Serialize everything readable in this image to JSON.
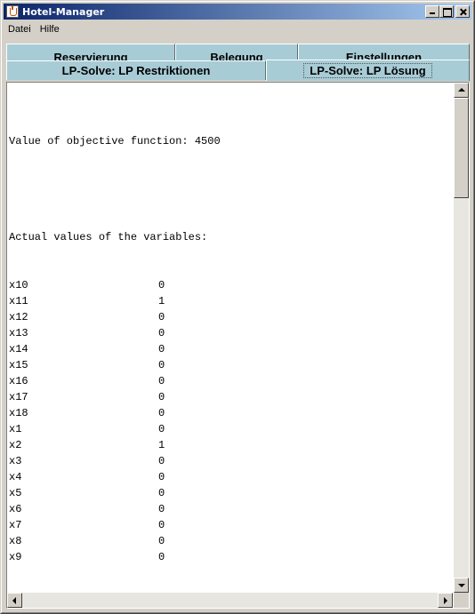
{
  "window": {
    "title": "Hotel-Manager"
  },
  "menu": [
    "Datei",
    "Hilfe"
  ],
  "tabs": {
    "row1": [
      "Reservierung",
      "Belegung",
      "Einstellungen"
    ],
    "row2": [
      "LP-Solve: LP Restriktionen",
      "LP-Solve: LP Lösung"
    ],
    "selected": "LP-Solve: LP Lösung"
  },
  "output": {
    "objective_line": "Value of objective function: 4500",
    "variables_header": "Actual values of the variables:",
    "variables": [
      {
        "name": "x10",
        "value": "0"
      },
      {
        "name": "x11",
        "value": "1"
      },
      {
        "name": "x12",
        "value": "0"
      },
      {
        "name": "x13",
        "value": "0"
      },
      {
        "name": "x14",
        "value": "0"
      },
      {
        "name": "x15",
        "value": "0"
      },
      {
        "name": "x16",
        "value": "0"
      },
      {
        "name": "x17",
        "value": "0"
      },
      {
        "name": "x18",
        "value": "0"
      },
      {
        "name": "x1",
        "value": "0"
      },
      {
        "name": "x2",
        "value": "1"
      },
      {
        "name": "x3",
        "value": "0"
      },
      {
        "name": "x4",
        "value": "0"
      },
      {
        "name": "x5",
        "value": "0"
      },
      {
        "name": "x6",
        "value": "0"
      },
      {
        "name": "x7",
        "value": "0"
      },
      {
        "name": "x8",
        "value": "0"
      },
      {
        "name": "x9",
        "value": "0"
      }
    ]
  },
  "colors": {
    "tab_bg": "#a8ccd6",
    "title_start": "#0a246a",
    "title_end": "#a6caf0",
    "window_bg": "#d4d0c8"
  }
}
